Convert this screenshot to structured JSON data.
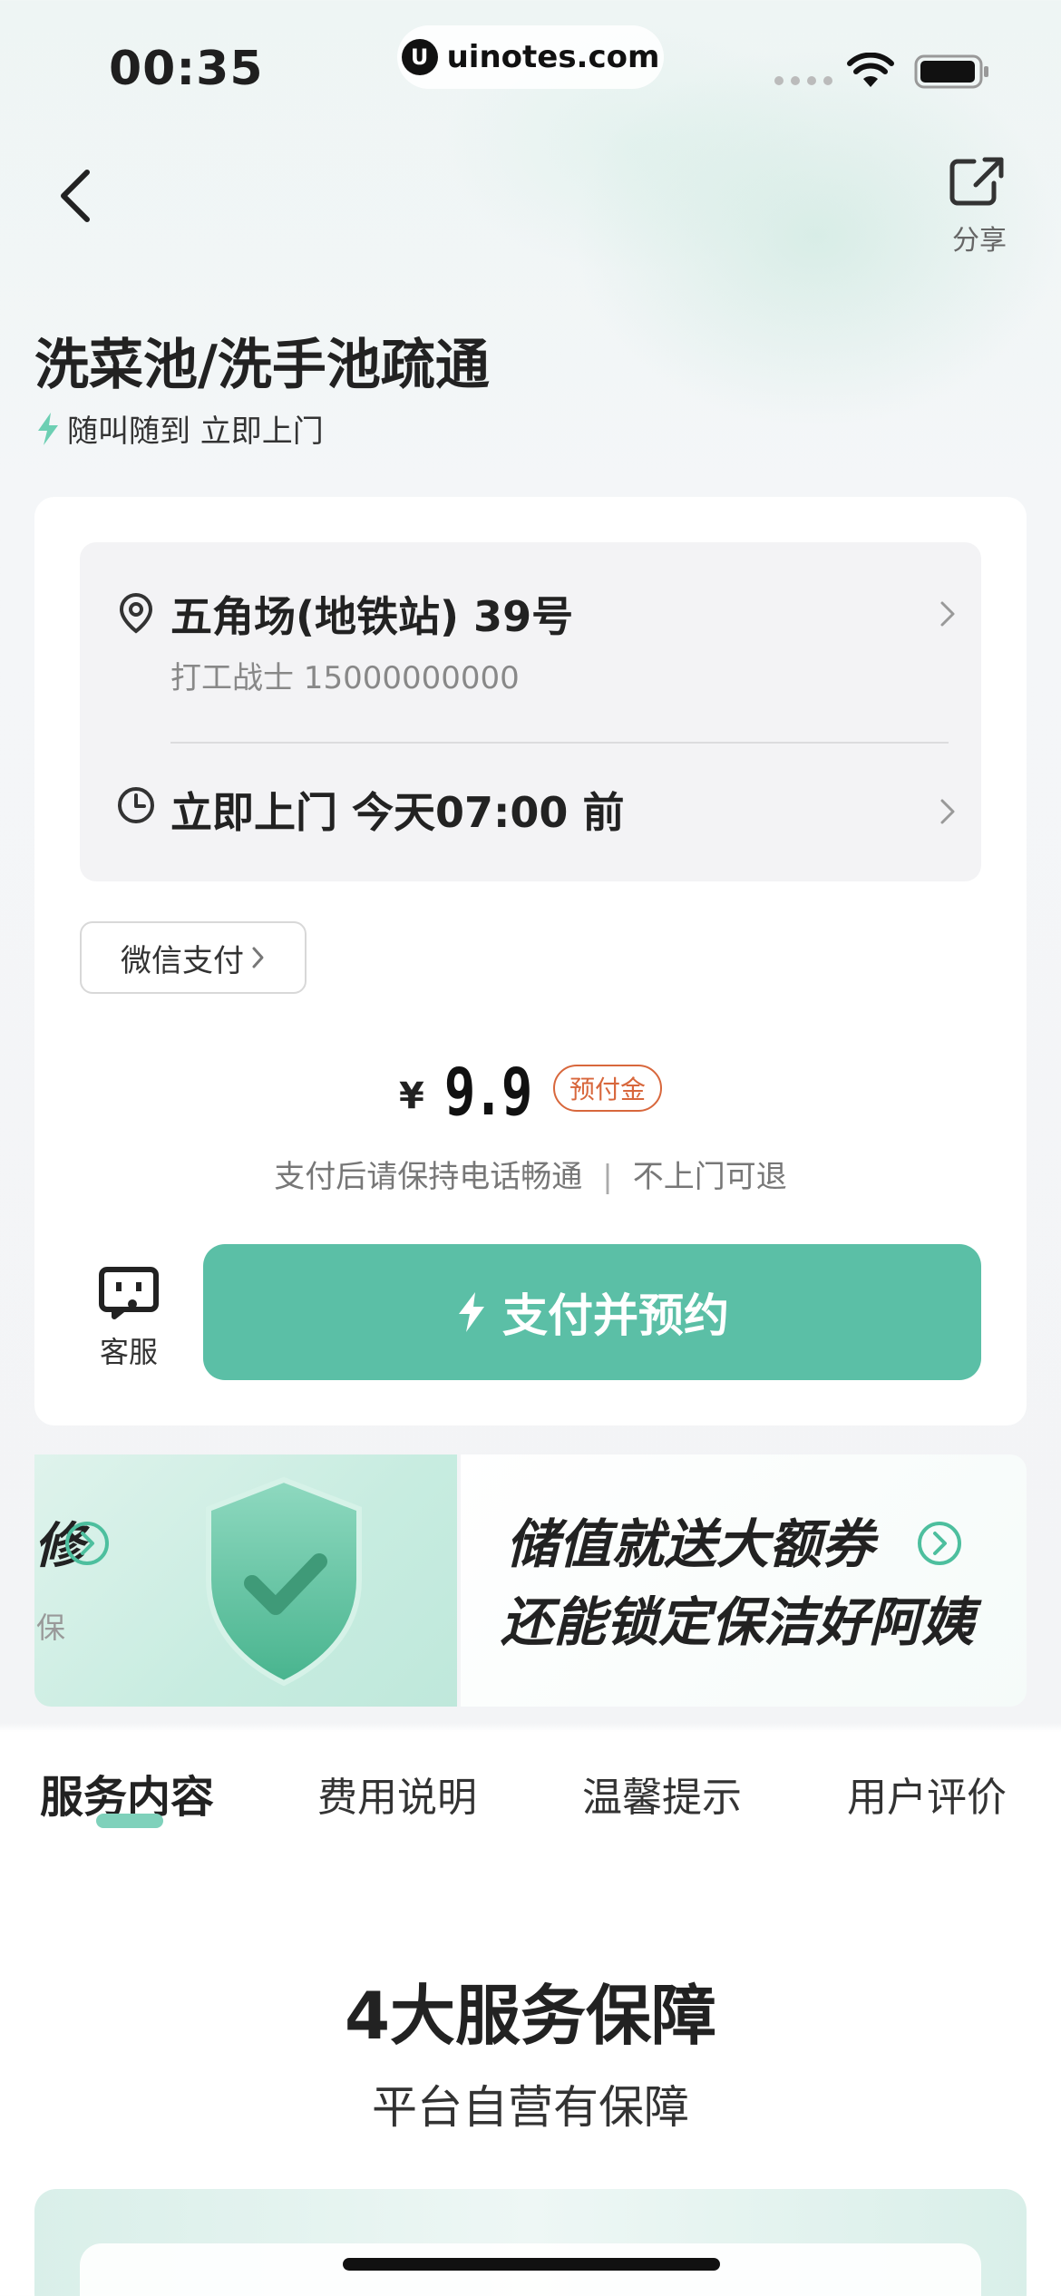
{
  "status_bar": {
    "time": "00:35",
    "watermark": "uinotes.com",
    "watermark_logo": "U"
  },
  "nav": {
    "share_label": "分享"
  },
  "header": {
    "title": "洗菜池/洗手池疏通",
    "tagline": "随叫随到 立即上门"
  },
  "order": {
    "address_title": "五角场(地铁站) 39号",
    "contact": "打工战士 15000000000",
    "visit_time": "立即上门 今天07:00 前",
    "payment_method": "微信支付",
    "price_symbol": "¥",
    "price": "9.9",
    "price_badge": "预付金",
    "note_left": "支付后请保持电话畅通",
    "note_sep": "|",
    "note_right": "不上门可退",
    "service_label": "客服",
    "pay_button_label": "支付并预约"
  },
  "banners": {
    "left_partial_title": "修",
    "left_partial_sub": "保",
    "right_line1": "储值就送大额券",
    "right_line2": "还能锁定保洁好阿姨"
  },
  "tabs": [
    {
      "label": "服务内容",
      "active": true
    },
    {
      "label": "费用说明",
      "active": false
    },
    {
      "label": "温馨提示",
      "active": false
    },
    {
      "label": "用户评价",
      "active": false
    }
  ],
  "section": {
    "title": "4大服务保障",
    "subtitle": "平台自营有保障"
  },
  "colors": {
    "accent": "#5bbfa6",
    "badge": "#d8673c",
    "tab_underline": "#7fd1bb"
  },
  "icons": {
    "back": "chevron-left-icon",
    "share": "share-icon",
    "location": "location-pin-icon",
    "clock": "clock-icon",
    "service": "headset-icon",
    "bolt": "lightning-icon",
    "shield": "shield-check-icon"
  }
}
